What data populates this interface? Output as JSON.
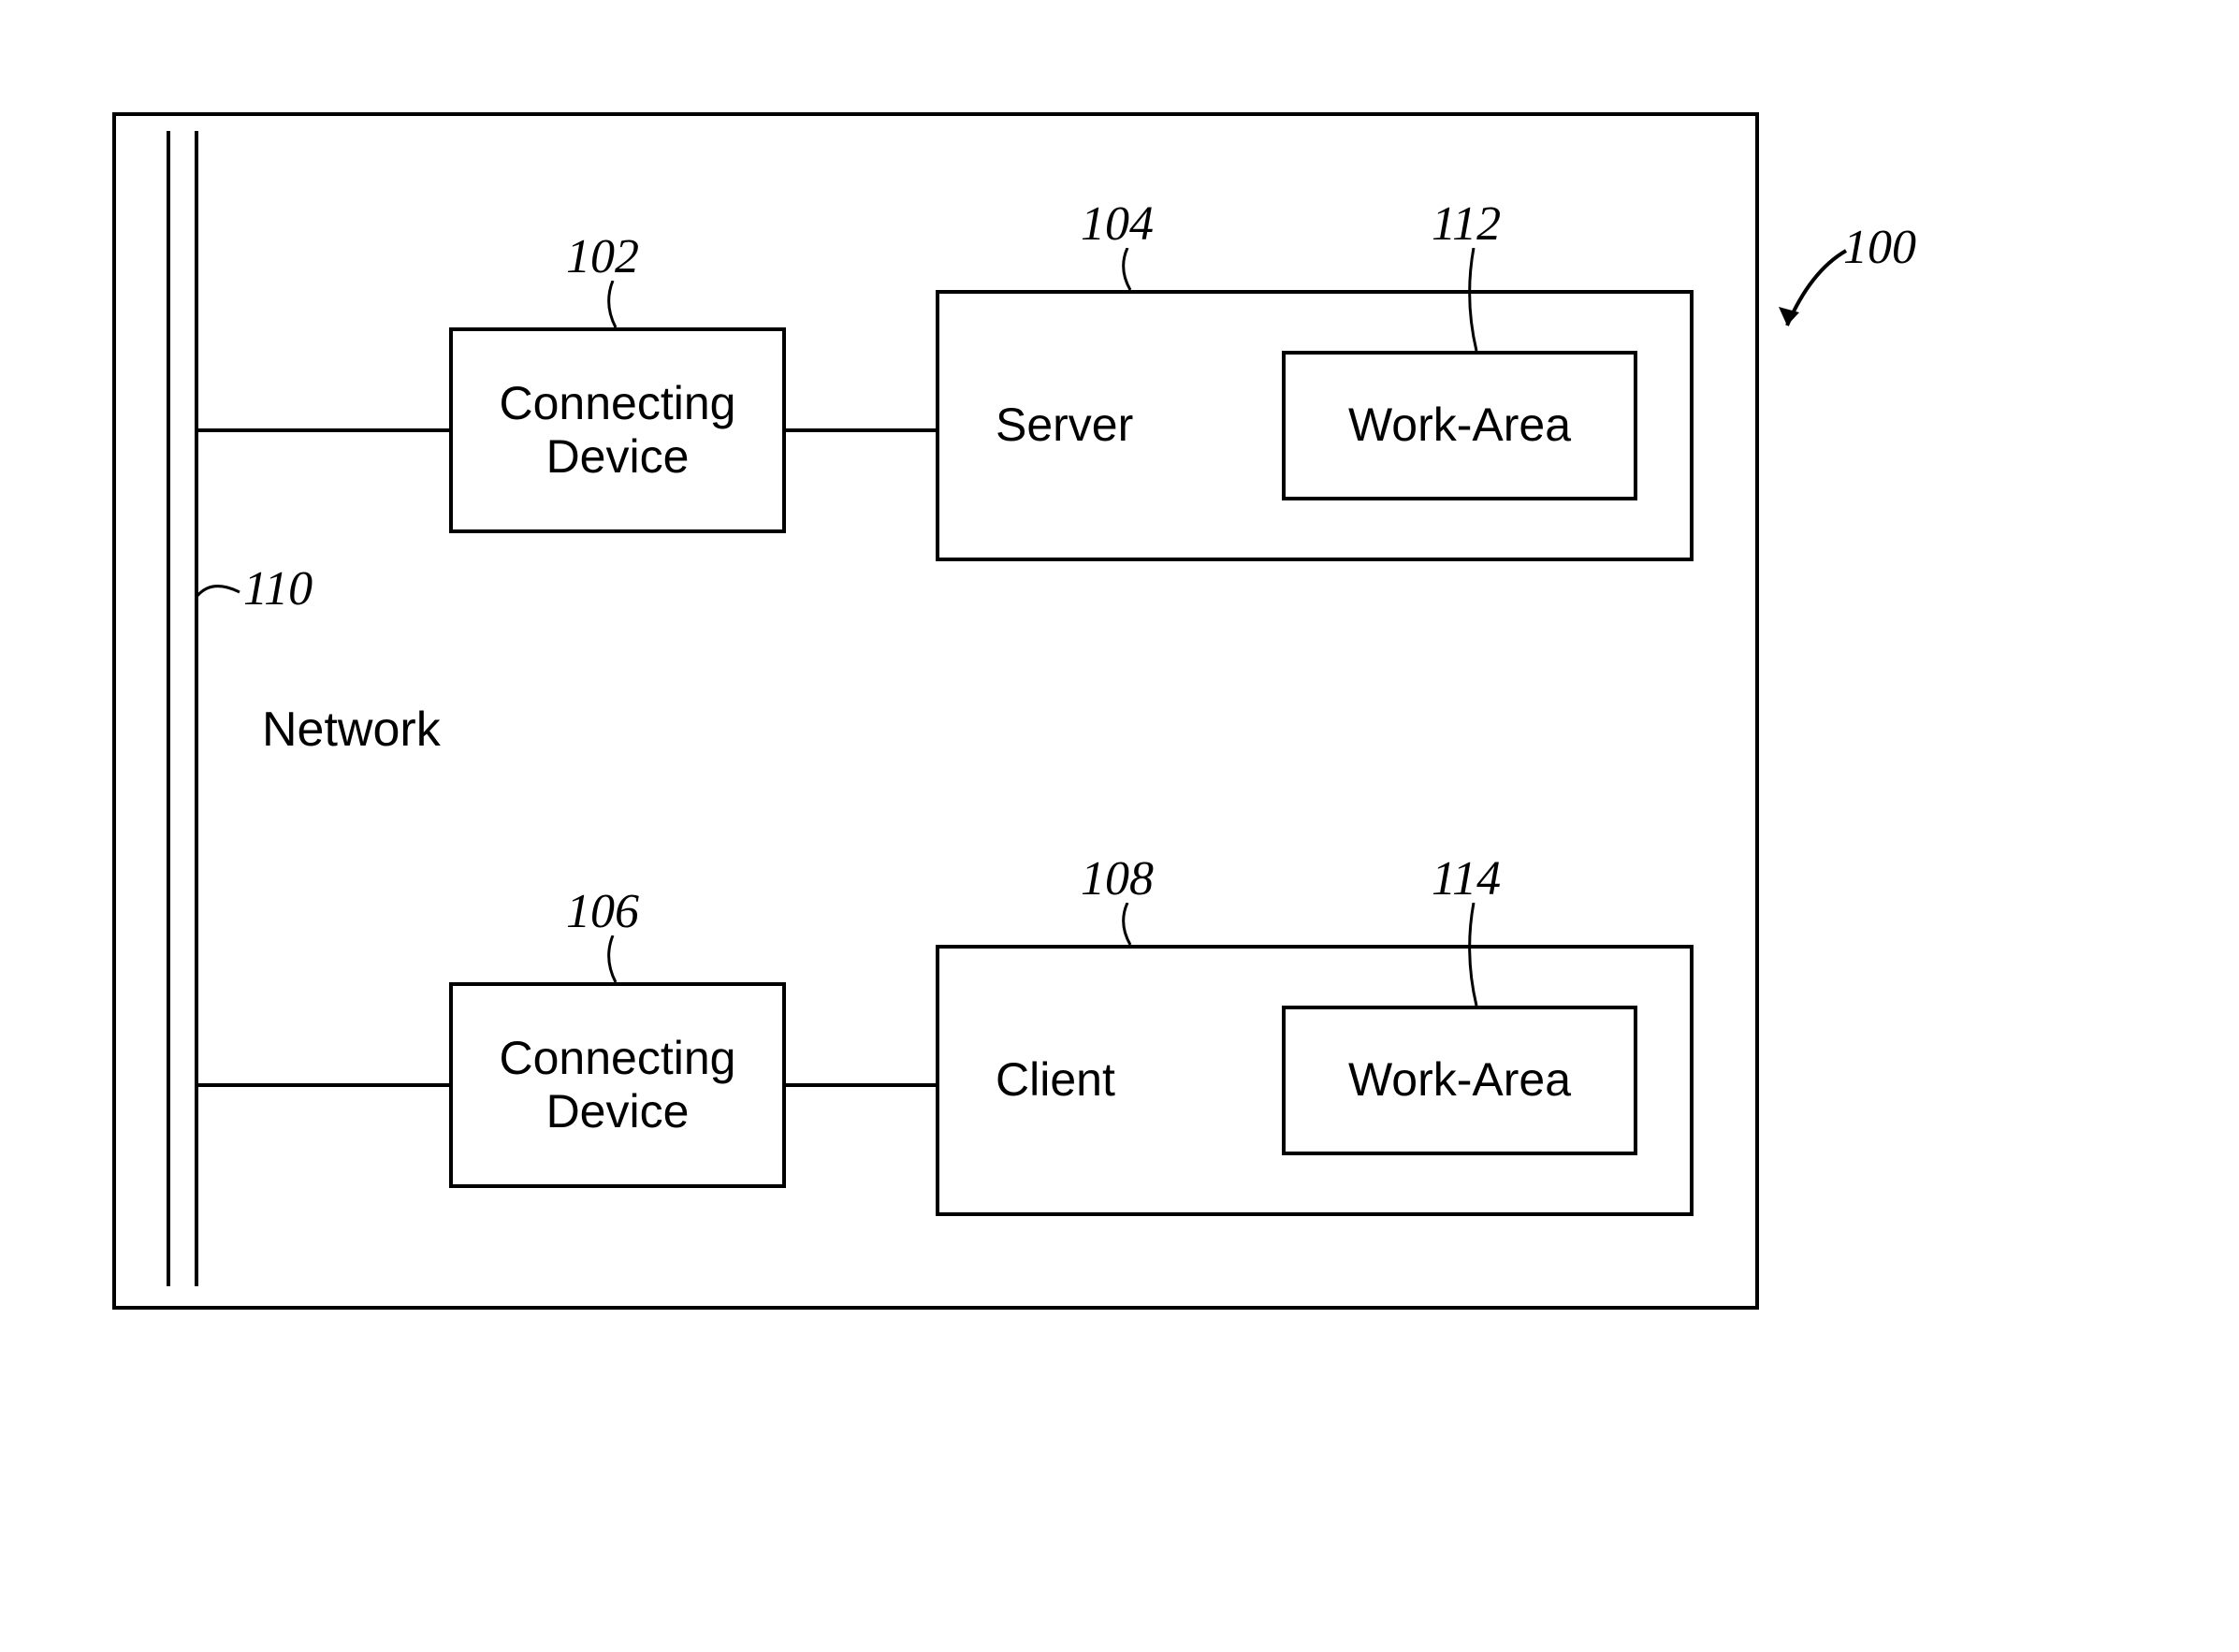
{
  "labels": {
    "system_ref": "100",
    "conn_dev_top_ref": "102",
    "server_ref": "104",
    "conn_dev_bottom_ref": "106",
    "client_ref": "108",
    "network_ref": "110",
    "workarea_top_ref": "112",
    "workarea_bottom_ref": "114",
    "network_text": "Network"
  },
  "boxes": {
    "conn_dev": "Connecting\nDevice",
    "server": "Server",
    "client": "Client",
    "workarea": "Work-Area"
  }
}
